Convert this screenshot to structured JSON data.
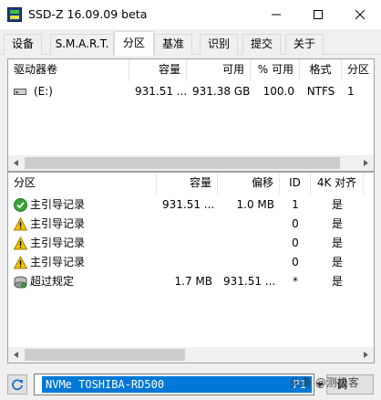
{
  "window": {
    "title": "SSD-Z 16.09.09 beta"
  },
  "tabs": [
    {
      "label": "设备"
    },
    {
      "label": "S.M.A.R.T."
    },
    {
      "label": "分区"
    },
    {
      "label": "基准"
    },
    {
      "label": "识别"
    },
    {
      "label": "提交"
    },
    {
      "label": "关于"
    }
  ],
  "volumes": {
    "headers": [
      "驱动器卷",
      "容量",
      "可用",
      "% 可用",
      "格式",
      "分区"
    ],
    "rows": [
      {
        "name": "(E:)",
        "capacity": "931.51 ...",
        "free": "931.38 GB",
        "pct_free": "100.0",
        "format": "NTFS",
        "partition": "1"
      }
    ]
  },
  "partitions": {
    "headers": [
      "分区",
      "容量",
      "偏移",
      "ID",
      "4K 对齐"
    ],
    "rows": [
      {
        "icon": "check-icon",
        "name": "主引导记录",
        "capacity": "931.51 ...",
        "offset": "1.0 MB",
        "id": "1",
        "aligned": "是"
      },
      {
        "icon": "warning-icon",
        "name": "主引导记录",
        "capacity": "",
        "offset": "",
        "id": "0",
        "aligned": "是"
      },
      {
        "icon": "warning-icon",
        "name": "主引导记录",
        "capacity": "",
        "offset": "",
        "id": "0",
        "aligned": "是"
      },
      {
        "icon": "warning-icon",
        "name": "主引导记录",
        "capacity": "",
        "offset": "",
        "id": "0",
        "aligned": "是"
      },
      {
        "icon": "disk-icon",
        "name": "超过规定",
        "capacity": "1.7 MB",
        "offset": "931.51 ...",
        "id": "*",
        "aligned": "是"
      }
    ]
  },
  "bottom": {
    "drive_name": "NVMe TOSHIBA-RD500",
    "drive_partition": "P1",
    "side_button": "调",
    "watermark": "头条 @测极客"
  },
  "colors": {
    "accent": "#0078d7",
    "selection_border": "#7a7a7a"
  }
}
